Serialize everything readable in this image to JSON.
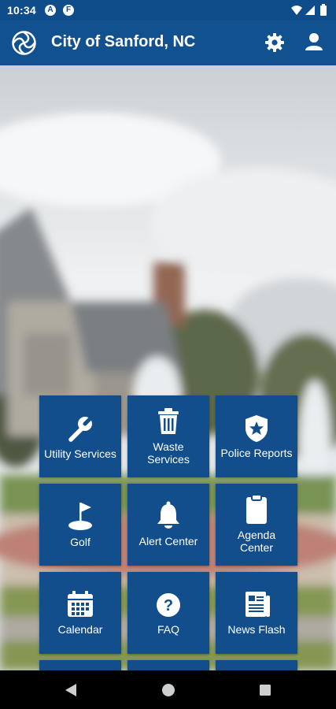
{
  "status_bar": {
    "time": "10:34",
    "notification_icons": [
      "a-icon",
      "f-icon"
    ],
    "right_icons": [
      "wifi-icon",
      "signal-icon",
      "battery-icon"
    ]
  },
  "app_bar": {
    "title": "City of Sanford, NC",
    "logo_icon": "city-logo-icon",
    "actions": [
      "gear-icon",
      "user-icon"
    ]
  },
  "tiles": [
    {
      "label": "Utility Services",
      "icon": "wrench-icon"
    },
    {
      "label": "Waste\nServices",
      "icon": "trash-icon"
    },
    {
      "label": "Police Reports",
      "icon": "police-badge-icon"
    },
    {
      "label": "Golf",
      "icon": "golf-flag-icon"
    },
    {
      "label": "Alert Center",
      "icon": "bell-icon"
    },
    {
      "label": "Agenda\nCenter",
      "icon": "clipboard-icon"
    },
    {
      "label": "Calendar",
      "icon": "calendar-icon"
    },
    {
      "label": "FAQ",
      "icon": "question-icon"
    },
    {
      "label": "News Flash",
      "icon": "newspaper-icon"
    }
  ],
  "nav_bar": [
    "back-icon",
    "home-icon",
    "recents-icon"
  ],
  "colors": {
    "primary": "#12518f",
    "status": "#0f4c8a",
    "tile": "#124e8b"
  }
}
